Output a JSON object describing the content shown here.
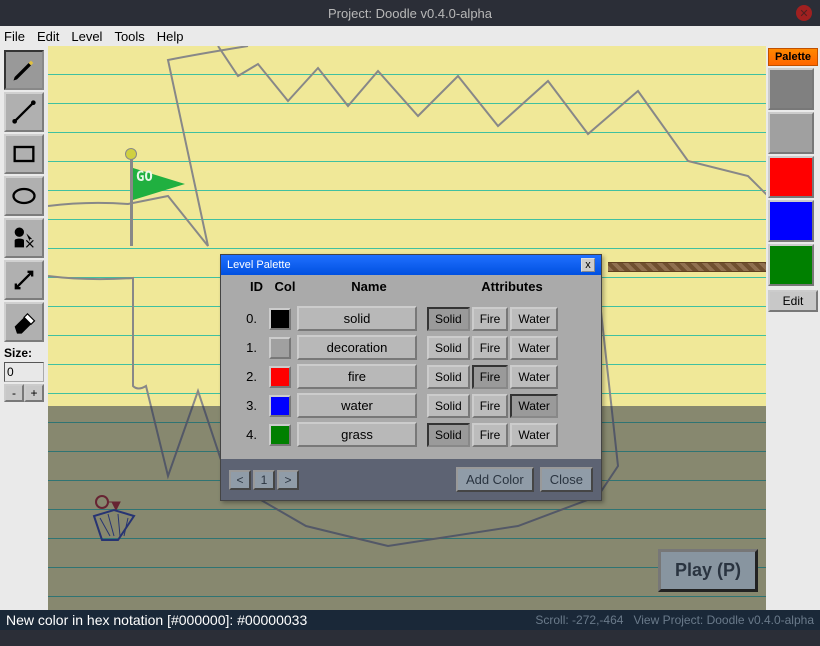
{
  "window": {
    "title": "Project: Doodle v0.4.0-alpha"
  },
  "menu": {
    "file": "File",
    "edit": "Edit",
    "level": "Level",
    "tools": "Tools",
    "help": "Help"
  },
  "tools": {
    "size_label": "Size:",
    "size_value": "0",
    "minus": "-",
    "plus": "+"
  },
  "palette_sidebar": {
    "label": "Palette",
    "edit_label": "Edit",
    "swatches": [
      {
        "color": "#808080"
      },
      {
        "color": "#a0a0a0"
      },
      {
        "color": "#ff0000"
      },
      {
        "color": "#0000ff"
      },
      {
        "color": "#008000"
      }
    ]
  },
  "flag_text": "GO",
  "dialog": {
    "title": "Level Palette",
    "headers": {
      "id": "ID",
      "col": "Col",
      "name": "Name",
      "attr": "Attributes"
    },
    "attr_labels": {
      "solid": "Solid",
      "fire": "Fire",
      "water": "Water"
    },
    "rows": [
      {
        "id": "0.",
        "color": "#000000",
        "name": "solid",
        "solid": true,
        "fire": false,
        "water": false
      },
      {
        "id": "1.",
        "color": "#a0a0a0",
        "name": "decoration",
        "solid": false,
        "fire": false,
        "water": false
      },
      {
        "id": "2.",
        "color": "#ff0000",
        "name": "fire",
        "solid": false,
        "fire": true,
        "water": false
      },
      {
        "id": "3.",
        "color": "#0000ff",
        "name": "water",
        "solid": false,
        "fire": false,
        "water": true
      },
      {
        "id": "4.",
        "color": "#008000",
        "name": "grass",
        "solid": true,
        "fire": false,
        "water": false
      }
    ],
    "pager": {
      "prev": "<",
      "page": "1",
      "next": ">"
    },
    "add_color": "Add Color",
    "close": "Close"
  },
  "play_button": "Play (P)",
  "status": {
    "message": "New color in hex notation [#000000]: #00000033",
    "scroll": "Scroll: -272,-464",
    "view": "View Project: Doodle v0.4.0-alpha"
  }
}
